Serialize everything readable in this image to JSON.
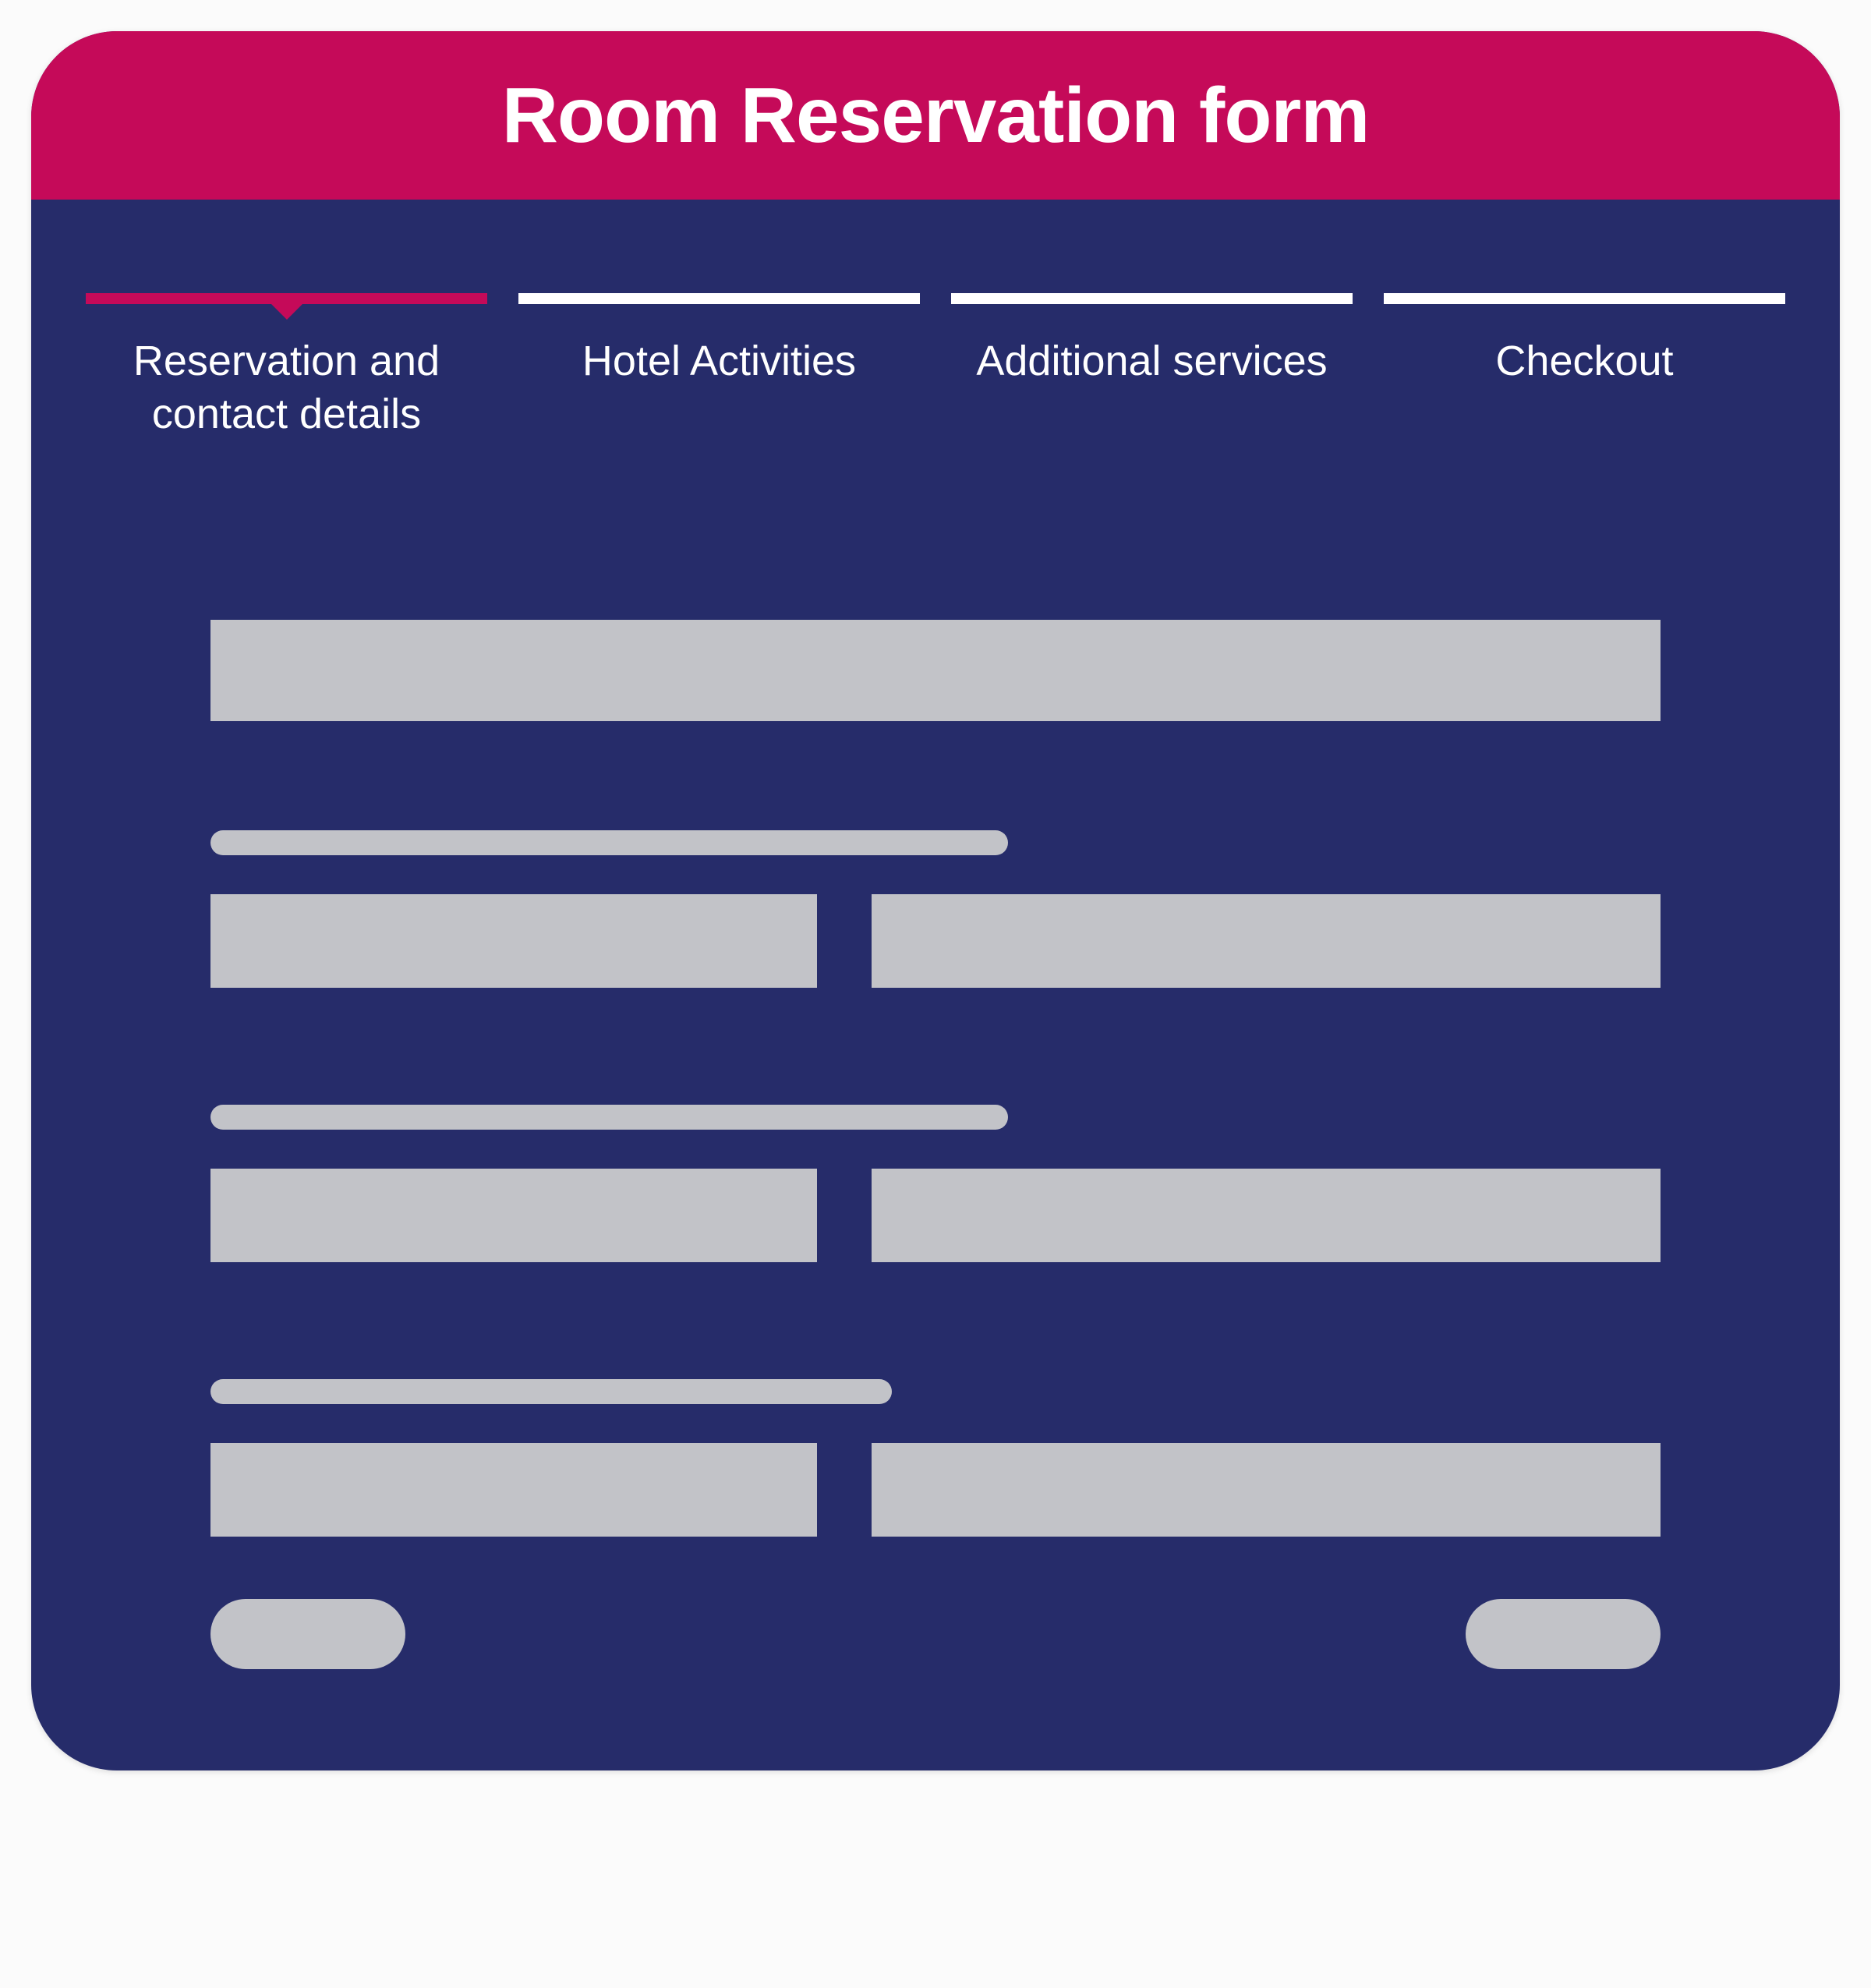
{
  "header": {
    "title": "Room Reservation form"
  },
  "steps": [
    {
      "label": "Reservation and contact details",
      "active": true
    },
    {
      "label": "Hotel Activities",
      "active": false
    },
    {
      "label": "Additional services",
      "active": false
    },
    {
      "label": "Checkout",
      "active": false
    }
  ],
  "colors": {
    "accent": "#c50a59",
    "panel": "#262c6a",
    "placeholder": "#c2c3c8",
    "text": "#ffffff"
  }
}
